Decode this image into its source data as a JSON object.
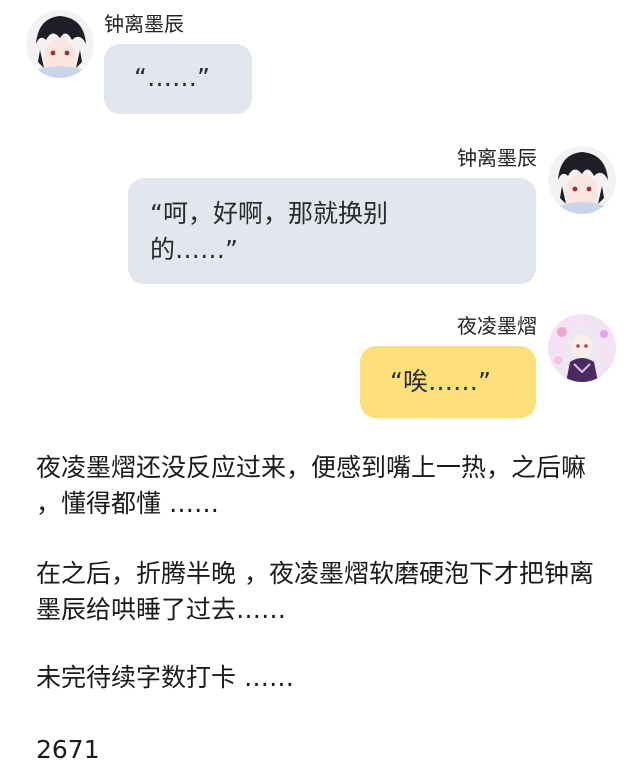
{
  "messages": [
    {
      "sender": "钟离墨辰",
      "text": "“……”",
      "side": "left",
      "avatar": "dark-haired-boy-avatar"
    },
    {
      "sender": "钟离墨辰",
      "text": "“呵，好啊，那就换别的……”",
      "side": "right",
      "avatar": "dark-haired-boy-avatar"
    },
    {
      "sender": "夜凌墨熠",
      "text": "“唉……”",
      "side": "right",
      "avatar": "silver-haired-girl-avatar"
    }
  ],
  "story": {
    "paragraph_1": "夜凌墨熠还没反应过来，便感到嘴上一热，之后嘛 ，懂得都懂 ……",
    "paragraph_2": "在之后，折腾半晚 ，夜凌墨熠软磨硬泡下才把钟离墨辰给哄睡了过去……",
    "paragraph_3": "未完待续字数打卡 ……",
    "word_count": "2671"
  },
  "colors": {
    "gray_bubble": "#e2e6ef",
    "yellow_bubble": "#fde07a",
    "background": "#ffffff"
  }
}
